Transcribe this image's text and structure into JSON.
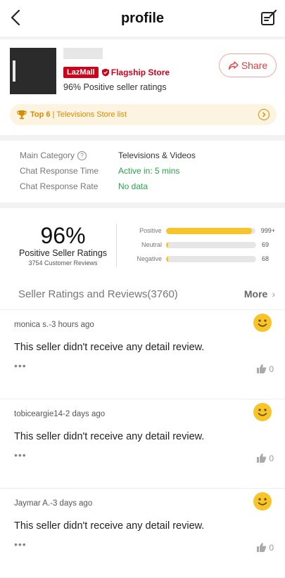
{
  "header": {
    "title": "profile",
    "back_icon": "chevron-left-icon",
    "edit_icon": "edit-note-icon"
  },
  "store": {
    "badge_lazmall": "LazMall",
    "badge_flagship": "Flagship Store",
    "ratings_line": "96% Positive seller ratings",
    "share_label": "Share",
    "top_rank": "Top 6",
    "top_list": "Televisions Store list"
  },
  "category": {
    "rows": [
      {
        "label": "Main Category",
        "value": "Televisions & Videos"
      },
      {
        "label": "Chat Response Time",
        "value": "Active in: 5 mins"
      },
      {
        "label": "Chat Response Rate",
        "value": "No data"
      }
    ]
  },
  "summary": {
    "percent": "96%",
    "label": "Positive Seller Ratings",
    "reviews": "3754 Customer Reviews",
    "bars": [
      {
        "label": "Positive",
        "count": "999+",
        "fill": 0.96
      },
      {
        "label": "Neutral",
        "count": "69",
        "fill": 0.02
      },
      {
        "label": "Negative",
        "count": "68",
        "fill": 0.02
      }
    ]
  },
  "reviews_header": {
    "title": "Seller Ratings and Reviews(3760)",
    "more": "More"
  },
  "reviews": [
    {
      "meta": "monica s.-3 hours ago",
      "text": "This seller didn't receive any detail review.",
      "likes": "0"
    },
    {
      "meta": "tobiceargie14-2 days ago",
      "text": "This seller didn't receive any detail review.",
      "likes": "0"
    },
    {
      "meta": "Jaymar A.-3 days ago",
      "text": "This seller didn't receive any detail review.",
      "likes": "0"
    }
  ],
  "colors": {
    "accent_red": "#d0021b",
    "rating_yellow": "#f7c42a",
    "active_green": "#2aa24c",
    "top_orange": "#d88c00"
  }
}
